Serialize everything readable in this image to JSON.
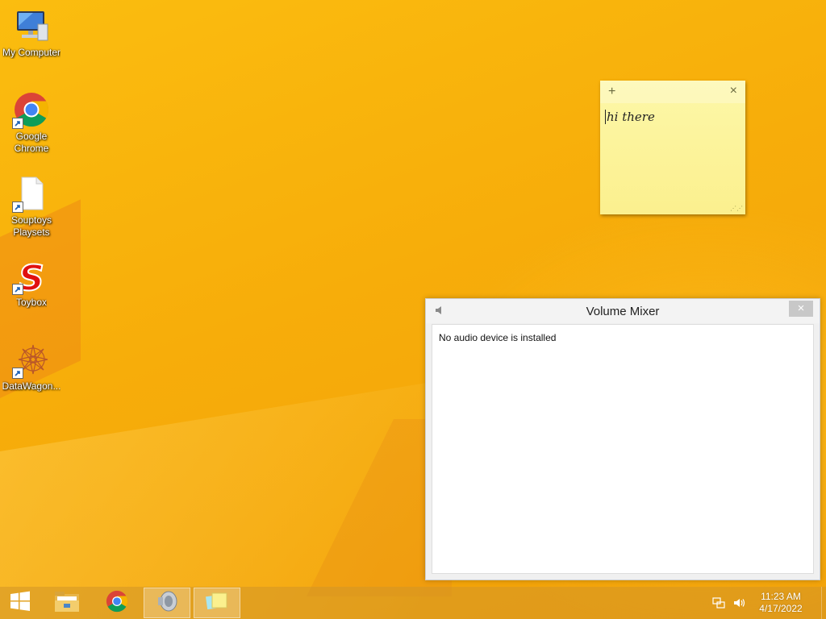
{
  "desktop": {
    "icons": [
      {
        "label": "My Computer",
        "icon": "monitor-icon"
      },
      {
        "label": "Google Chrome",
        "icon": "chrome-icon"
      },
      {
        "label": "Souptoys Playsets",
        "icon": "document-icon"
      },
      {
        "label": "Toybox",
        "icon": "toybox-s-icon"
      },
      {
        "label": "DataWagon...",
        "icon": "datawagon-icon"
      }
    ]
  },
  "sticky_note": {
    "text": "hi there",
    "add_symbol": "+",
    "close_symbol": "×"
  },
  "volume_mixer": {
    "title": "Volume Mixer",
    "close_symbol": "×",
    "message": "No audio device is installed"
  },
  "taskbar": {
    "items": [
      {
        "name": "start",
        "icon": "windows-logo-icon"
      },
      {
        "name": "file-explorer",
        "icon": "folder-icon"
      },
      {
        "name": "chrome",
        "icon": "chrome-icon"
      },
      {
        "name": "volume-mixer",
        "icon": "speaker-icon",
        "active": true
      },
      {
        "name": "sticky-notes",
        "icon": "sticky-notes-icon",
        "active": true
      }
    ],
    "clock": {
      "time": "11:23 AM",
      "date": "4/17/2022"
    }
  },
  "colors": {
    "wallpaper": "#f7ad0a",
    "sticky": "#fbf08e",
    "chrome_red": "#db4437",
    "chrome_green": "#0f9d58",
    "chrome_yellow": "#f4b400",
    "chrome_blue": "#4285f4"
  }
}
